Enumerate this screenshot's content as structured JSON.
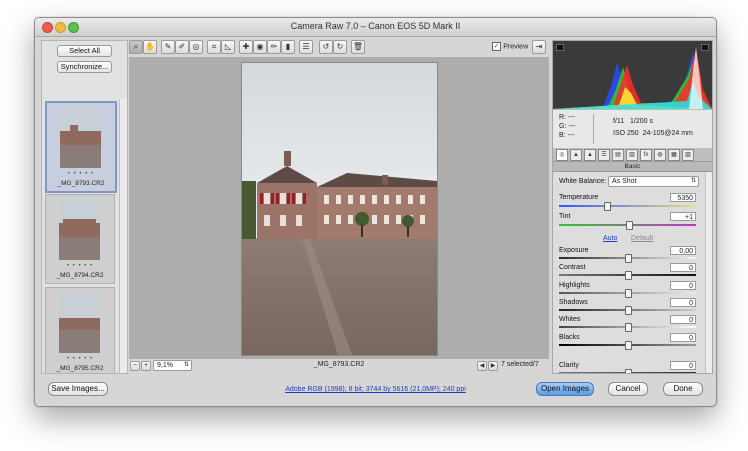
{
  "window": {
    "title": "Camera Raw 7.0  –  Canon EOS 5D Mark II"
  },
  "left_panel": {
    "select_all": "Select All",
    "synchronize": "Synchronize..."
  },
  "filmstrip": [
    {
      "name": "_MG_8793.CR2",
      "stars": "• • • • •",
      "selected": true
    },
    {
      "name": "_MG_8794.CR2",
      "stars": "• • • • •",
      "selected": false
    },
    {
      "name": "_MG_8795.CR2",
      "stars": "• • • • •",
      "selected": false
    }
  ],
  "toolbar": {
    "icons": [
      "zoom-icon",
      "hand-icon",
      "white-balance-icon",
      "color-sampler-icon",
      "target-adjust-icon",
      "crop-icon",
      "straighten-icon",
      "spot-removal-icon",
      "red-eye-icon",
      "adjustment-brush-icon",
      "graduated-filter-icon",
      "preferences-icon",
      "rotate-left-icon",
      "rotate-right-icon",
      "trash-icon"
    ],
    "glyphs": [
      "⌕",
      "✋",
      "✎",
      "✐",
      "◎",
      "⌗",
      "◺",
      "✚",
      "◉",
      "✏",
      "▮",
      "☰",
      "↺",
      "↻",
      "🗑"
    ],
    "preview_label": "Preview",
    "preview_checked": true
  },
  "bottom_bar": {
    "zoom_minus": "−",
    "zoom_plus": "+",
    "zoom_value": "9,1%",
    "filename": "_MG_8793.CR2",
    "selected_count": "7 selected/7"
  },
  "histogram": {
    "colors": {
      "red": "#ff2a2a",
      "green": "#29d129",
      "blue": "#2a4bff",
      "yellow": "#ffee33",
      "cyan": "#22e5e5"
    }
  },
  "info": {
    "r": "R:",
    "g": "G:",
    "b": "B:",
    "r_val": "---",
    "g_val": "---",
    "b_val": "---",
    "aperture": "f/11",
    "shutter": "1/200 s",
    "iso": "ISO 250",
    "lens": "24-105@24 mm"
  },
  "panel_tabs": [
    "◎",
    "▲",
    "▲",
    "☰",
    "▤",
    "▥",
    "fx",
    "◍",
    "▦",
    "▧"
  ],
  "section": {
    "title": "Basic"
  },
  "basic": {
    "white_balance_label": "White Balance:",
    "white_balance_value": "As Shot",
    "temperature_label": "Temperature",
    "temperature_value": "5350",
    "tint_label": "Tint",
    "tint_value": "+1",
    "auto_label": "Auto",
    "default_label": "Default",
    "exposure_label": "Exposure",
    "exposure_value": "0,00",
    "contrast_label": "Contrast",
    "contrast_value": "0",
    "highlights_label": "Highlights",
    "highlights_value": "0",
    "shadows_label": "Shadows",
    "shadows_value": "0",
    "whites_label": "Whites",
    "whites_value": "0",
    "blacks_label": "Blacks",
    "blacks_value": "0",
    "clarity_label": "Clarity",
    "clarity_value": "0"
  },
  "footer": {
    "save_images": "Save Images...",
    "workflow_info": "Adobe RGB (1998); 8 bit; 3744 by 5616 (21,0MP); 240 ppi",
    "open_images": "Open Images",
    "cancel": "Cancel",
    "done": "Done"
  }
}
